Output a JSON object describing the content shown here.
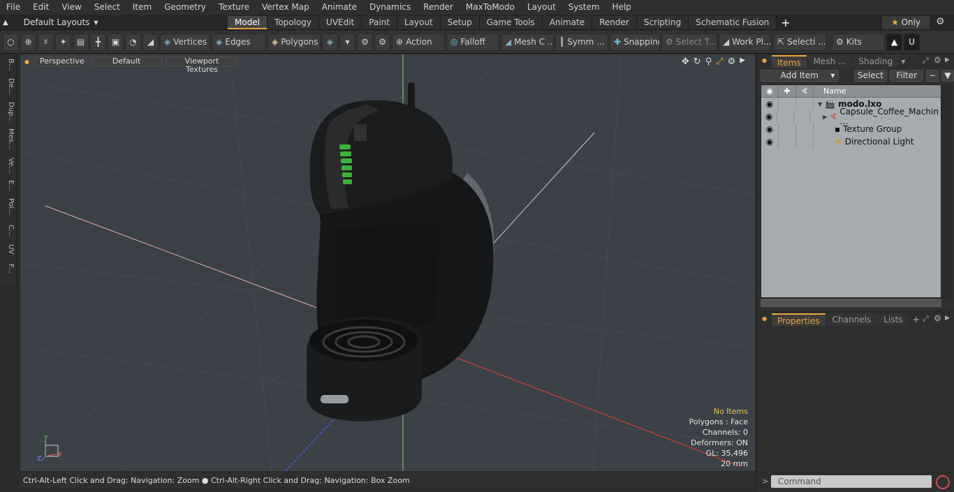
{
  "menu": [
    "File",
    "Edit",
    "View",
    "Select",
    "Item",
    "Geometry",
    "Texture",
    "Vertex Map",
    "Animate",
    "Dynamics",
    "Render",
    "MaxToModo",
    "Layout",
    "System",
    "Help"
  ],
  "layouts_label": "Default Layouts",
  "tabs": [
    "Model",
    "Topology",
    "UVEdit",
    "Paint",
    "Layout",
    "Setup",
    "Game Tools",
    "Animate",
    "Render",
    "Scripting",
    "Schematic Fusion"
  ],
  "only_label": "Only",
  "toolbar": {
    "vertices": "Vertices",
    "edges": "Edges",
    "polygons": "Polygons",
    "action": "Action",
    "falloff": "Falloff",
    "mesh": "Mesh C ...",
    "symm": "Symm ...",
    "snapping": "Snapping",
    "select_t": "Select T...",
    "work_pl": "Work Pl...",
    "selecti": "Selecti ...",
    "kits": "Kits"
  },
  "left_tabs": [
    "B...",
    "De...",
    "Dup...",
    "Mes...",
    "Ve...",
    "E...",
    "Pol...",
    "C...",
    "UV",
    "F..."
  ],
  "viewport": {
    "view_mode": "Perspective",
    "style": "Default",
    "textures": "Viewport Textures"
  },
  "hud": {
    "no_items": "No Items",
    "polygons": "Polygons : Face",
    "channels": "Channels: 0",
    "deformers": "Deformers: ON",
    "gl": "GL: 35,496",
    "scale": "20 mm"
  },
  "status_text": "Ctrl-Alt-Left Click and Drag: Navigation: Zoom ● Ctrl-Alt-Right Click and Drag: Navigation: Box Zoom",
  "items_panel": {
    "tabs": [
      "Items",
      "Mesh ...",
      "Shading"
    ],
    "add_item": "Add Item",
    "select": "Select",
    "filter": "Filter",
    "col_name": "Name",
    "rows": [
      "modo.lxo",
      "Capsule_Coffee_Machin ...",
      "Texture Group",
      "Directional Light"
    ]
  },
  "properties_panel": {
    "tabs": [
      "Properties",
      "Channels",
      "Lists"
    ]
  },
  "command_placeholder": "Command",
  "colors": {
    "accent": "#e8a43b",
    "viewport_bg": "#3b4147"
  }
}
